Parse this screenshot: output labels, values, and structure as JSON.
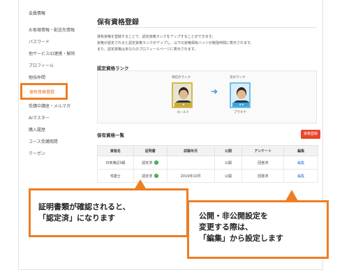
{
  "sidebar": {
    "title": "会員情報",
    "items": [
      {
        "label": "お客様情報・配送先情報"
      },
      {
        "label": "パスワード"
      },
      {
        "label": "他サービスID連携・解除"
      },
      {
        "label": "プロフィール"
      },
      {
        "label": "勉強仲間"
      },
      {
        "label": "保有資格登録",
        "active": true
      },
      {
        "label": "受講中講座・メルマガ"
      },
      {
        "label": "AIマスター"
      },
      {
        "label": "購入履歴"
      },
      {
        "label": "コース受講期間"
      },
      {
        "label": "クーポン"
      }
    ]
  },
  "main": {
    "title": "保有資格登録",
    "description": [
      "保有資格を登録することで、認定資格ランクをアップすることができます。",
      "資格が認定されると認定資格ランクがアップし、以下の資格保有バッジが勉強仲間に表示されます。",
      "また、認定資格はあなたのプロフィールページに表示されます。"
    ],
    "rank": {
      "heading": "認定資格ランク",
      "current_label": "現在のランク",
      "current_name": "ゴールド",
      "next_label": "次のランク",
      "next_name": "プラチナ",
      "arrow": "➔"
    },
    "list": {
      "heading": "保有資格一覧",
      "add_button": "資格登録",
      "columns": [
        "資格名",
        "証明書",
        "試験年月",
        "公開",
        "アンケート",
        "編集"
      ],
      "rows": [
        {
          "name": "日商簿記3級",
          "cert": "認定済",
          "date": "",
          "public": "公開",
          "survey": "回答済",
          "edit": "編集"
        },
        {
          "name": "宅建士",
          "cert": "認定済",
          "date": "2019年10月",
          "public": "公開",
          "survey": "回答済",
          "edit": "編集"
        }
      ]
    }
  },
  "callouts": {
    "first": [
      "証明書類が確認されると、",
      "「認定済」になります"
    ],
    "second": [
      "公開・非公開設定を",
      "変更する際は、",
      "「編集」から設定します"
    ]
  },
  "colors": {
    "accent": "#ef7d22",
    "add_button": "#e8472b",
    "link": "#2b7bd6",
    "check": "#39a54a"
  }
}
